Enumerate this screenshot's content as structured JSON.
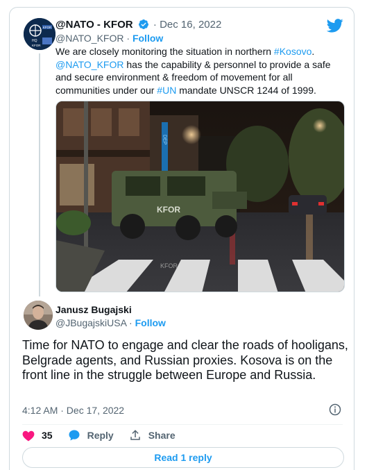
{
  "quoted_tweet": {
    "author_name": "@NATO - KFOR",
    "separator": "·",
    "date": "Dec 16, 2022",
    "handle": "@NATO_KFOR",
    "handle_separator": "·",
    "follow_label": "Follow",
    "text_part1": "We are closely monitoring the situation in northern ",
    "hashtag_kosovo": "#Kosovo",
    "text_part2": ".",
    "mention_kfor": "@NATO_KFOR",
    "text_part3": "  has the capability & personnel to provide a safe and secure environment & freedom of movement for all communities under our ",
    "hashtag_un": "#UN",
    "text_part4": " mandate UNSCR 1244 of 1999.",
    "photo_markings": {
      "vehicle_text": "KFOR",
      "road_text": "KFOR",
      "store_sign": "DEP"
    },
    "avatar_text": {
      "line1": "KFOR",
      "line2": "HQ",
      "line3": "KFOR"
    }
  },
  "main_tweet": {
    "author_name": "Janusz Bugajski",
    "handle": "@JBugajskiUSA",
    "handle_separator": "·",
    "follow_label": "Follow",
    "text": "Time for NATO to engage and clear the roads of hooligans, Belgrade agents, and Russian proxies. Kosova is on the front line in the struggle between Europe and Russia.",
    "timestamp": "4:12 AM · Dec 17, 2022"
  },
  "actions": {
    "like_count": "35",
    "reply_label": "Reply",
    "share_label": "Share"
  },
  "read_reply_label": "Read 1 reply",
  "colors": {
    "accent": "#1d9bf0",
    "like": "#f91880",
    "text": "#0f1419",
    "secondary": "#536471",
    "border": "#cfd9de"
  },
  "icons": [
    "twitter-logo-icon",
    "verified-badge-icon",
    "info-icon",
    "heart-icon",
    "reply-bubble-icon",
    "share-icon"
  ]
}
